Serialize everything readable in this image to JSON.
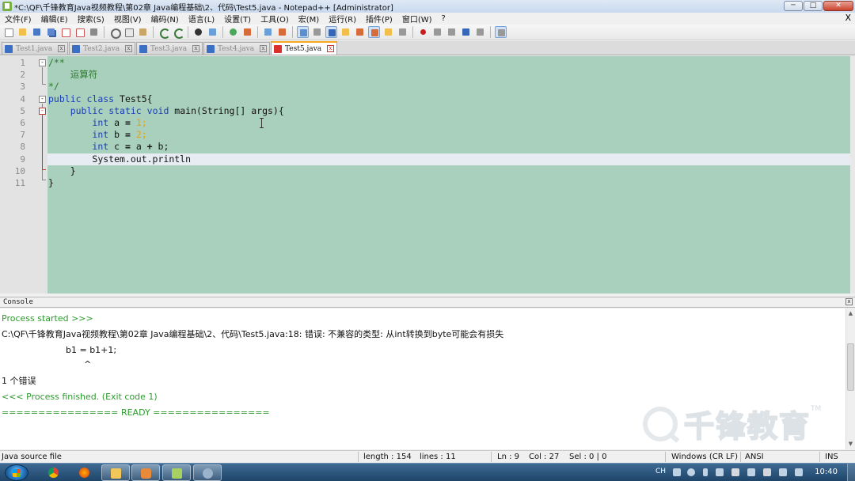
{
  "window": {
    "title": "*C:\\QF\\千锋教育Java视频教程\\第02章 Java编程基础\\2、代码\\Test5.java - Notepad++ [Administrator]",
    "minimize": "─",
    "maximize": "□",
    "close": "✕"
  },
  "menu": {
    "items": [
      "文件(F)",
      "编辑(E)",
      "搜索(S)",
      "视图(V)",
      "编码(N)",
      "语言(L)",
      "设置(T)",
      "工具(O)",
      "宏(M)",
      "运行(R)",
      "插件(P)",
      "窗口(W)",
      "?"
    ],
    "doc_close": "X"
  },
  "tabs": [
    {
      "label": "Test1.java",
      "active": false
    },
    {
      "label": "Test2.java",
      "active": false
    },
    {
      "label": "Test3.java",
      "active": false
    },
    {
      "label": "Test4.java",
      "active": false
    },
    {
      "label": "Test5.java",
      "active": true
    }
  ],
  "editor": {
    "line_numbers": [
      "1",
      "2",
      "3",
      "4",
      "5",
      "6",
      "7",
      "8",
      "9",
      "10",
      "11"
    ],
    "current_line": 9,
    "colors": {
      "background": "#a9cfbd",
      "keyword": "#1a3fb5",
      "comment": "#2c7a2c",
      "number": "#e6a010"
    }
  },
  "code": {
    "l1": "/**",
    "l2": "    运算符",
    "l3": "*/",
    "l4_kw1": "public",
    "l4_kw2": "class",
    "l4_rest": " Test5{",
    "l5_kw1": "public",
    "l5_kw2": "static",
    "l5_kw3": "void",
    "l5_rest": " main(String[] args){",
    "l6_kw": "int",
    "l6_a": " a ",
    "l6_eq": "=",
    "l6_n": " 1",
    "l6_end": ";",
    "l7_kw": "int",
    "l7_a": " b ",
    "l7_eq": "=",
    "l7_n": " 2",
    "l7_end": ";",
    "l8_kw": "int",
    "l8_a": " c ",
    "l8_eq": "=",
    "l8_b": " a ",
    "l8_plus": "+",
    "l8_end": " b;",
    "l9": "System.out.println",
    "l10": "}",
    "l11": "}"
  },
  "console": {
    "header": "Console",
    "close": "x",
    "lines": {
      "started": "Process started >>>",
      "error_path": "C:\\QF\\千锋教育Java视频教程\\第02章 Java编程基础\\2、代码\\Test5.java:18: 错误: 不兼容的类型: 从int转换到byte可能会有损失",
      "code": "b1 = b1+1;",
      "caret": "^",
      "error_count": "1 个错误",
      "finished": "<<< Process finished. (Exit code 1)",
      "ready": "================ READY ================"
    },
    "watermark": {
      "text": "千锋教育",
      "tm": "TM"
    }
  },
  "status": {
    "file_type": "Java source file",
    "length": "length : 154",
    "lines": "lines : 11",
    "ln": "Ln : 9",
    "col": "Col : 27",
    "sel": "Sel : 0 | 0",
    "eol": "Windows (CR LF)",
    "encoding": "ANSI",
    "mode": "INS"
  },
  "taskbar": {
    "lang": "CH",
    "time": "10:40"
  }
}
